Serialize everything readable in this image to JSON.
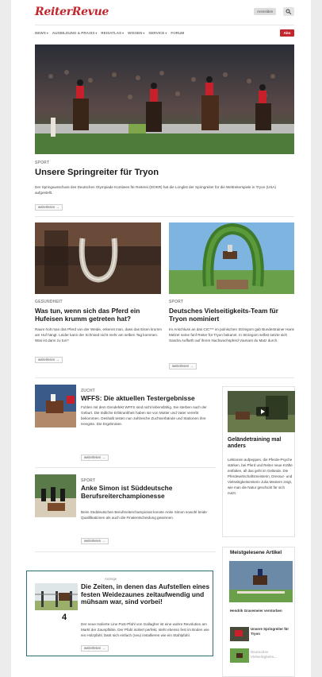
{
  "header": {
    "logo": "ReiterRevue",
    "login_label": "Anmelden",
    "abo_label": "Abo"
  },
  "nav": {
    "items": [
      {
        "label": "NEWS"
      },
      {
        "label": "AUSBILDUNG & PRAXIS"
      },
      {
        "label": "REISATLAS"
      },
      {
        "label": "WISSEN"
      },
      {
        "label": "SERVICE"
      },
      {
        "label": "FORUM"
      }
    ]
  },
  "hero": {
    "kicker": "SPORT",
    "title": "Unsere Springreiter für Tryon",
    "text": "Der Springausschuss des Deutschen Olympiade Komitees für Reiterei (DOKR) hat die Longlist der Springreiter für die Weltreiterspiele in Tryon (USA) aufgestellt.",
    "more": "weiterlesen →"
  },
  "card_left": {
    "kicker": "GESUNDHEIT",
    "title": "Was tun, wenn sich das Pferd ein Hufeisen krumm getreten hat?",
    "text": "Raum holt man das Pferd von der Weide, erkennt man, dass das Eisen krumm am Huf hängt. Leider kann der Schmied nicht mehr am selben Tag kommen. Was ist dann zu tun?",
    "more": "weiterlesen →"
  },
  "card_right": {
    "kicker": "SPORT",
    "title": "Deutsches Vielseitigkeits-Team für Tryon nominiert",
    "text": "Im Anschluss an das CIC*** im polnischen Strzegom gab Bundestrainer Hans Melzer seine fünf Reiter für Tryon bekannt. In Strzegom selbst setzte sich Sandra Auffarth auf ihrem Nachwuchspferd Viamant du Matz durch.",
    "more": "weiterlesen →"
  },
  "list_item_1": {
    "kicker": "ZUCHT",
    "title": "WFFS: Die aktuellen Testergebnisse",
    "text": "Fohlen mit dem Gendefekt WFFS sind nicht lebensfähig. Sie sterben nach der Geburt. Die tödliche Erbkrankheit haben sie von Mutter und Vater vererbt bekommen. Deshalb testen nun zahlreiche Zuchtverbände und Stationen ihre Hengste. Die Ergebnisse.",
    "more": "weiterlesen →"
  },
  "list_item_2": {
    "kicker": "SPORT",
    "title": "Anke Simon ist Süddeutsche Berufsreiterchampionesse",
    "text": "Beim Süddeutschen Berufsreiterchampionat konnte Anke Simon sowohl beide Qualifikationen als auch die Finalentscheidung gewinnen.",
    "more": "weiterlesen →"
  },
  "ad": {
    "label": "Anzeige",
    "title": "Die Zeiten, in denen das Aufstellen eines festen Weidezaunes zeitaufwendig und mühsam war, sind vorbei!",
    "text": "Der neue Isolierte Line Post-Pfahl von Gallagher ist eine wahre Revolution am Markt der Zaunpfähle. Der Pfahl isoliert perfekt, steht ebenso fest im Boden wie ein Holzpfahl, lässt sich einfach (neu) installieren wie ein Stahlpfahl.",
    "more": "weiterlesen →",
    "marker": "4"
  },
  "sidebar_video": {
    "title": "Geländetraining mal anders",
    "text": "Lektionen aufpeppen, die Pferde-Psyche stärken, bei Pferd und Reiter neue Kräfte entfalten, all das geht im Gelände. Die Pferdewirtschaftsmeisterin, Dressur- und Vielseitigkeitsreiterin Julia Mestern zeigt, wie man die Natur geschickt für sich nutzt."
  },
  "sidebar_popular": {
    "heading": "Meistgelesene Artikel",
    "top_caption": "Hendrik Gravemeier verstorben",
    "items": [
      {
        "title": "Unsere Springreiter für Tryon"
      },
      {
        "title": "Deutsches Vielseitigkeits..."
      }
    ]
  },
  "colors": {
    "brand_red": "#c1272d",
    "ad_border": "#2c6f7a"
  }
}
